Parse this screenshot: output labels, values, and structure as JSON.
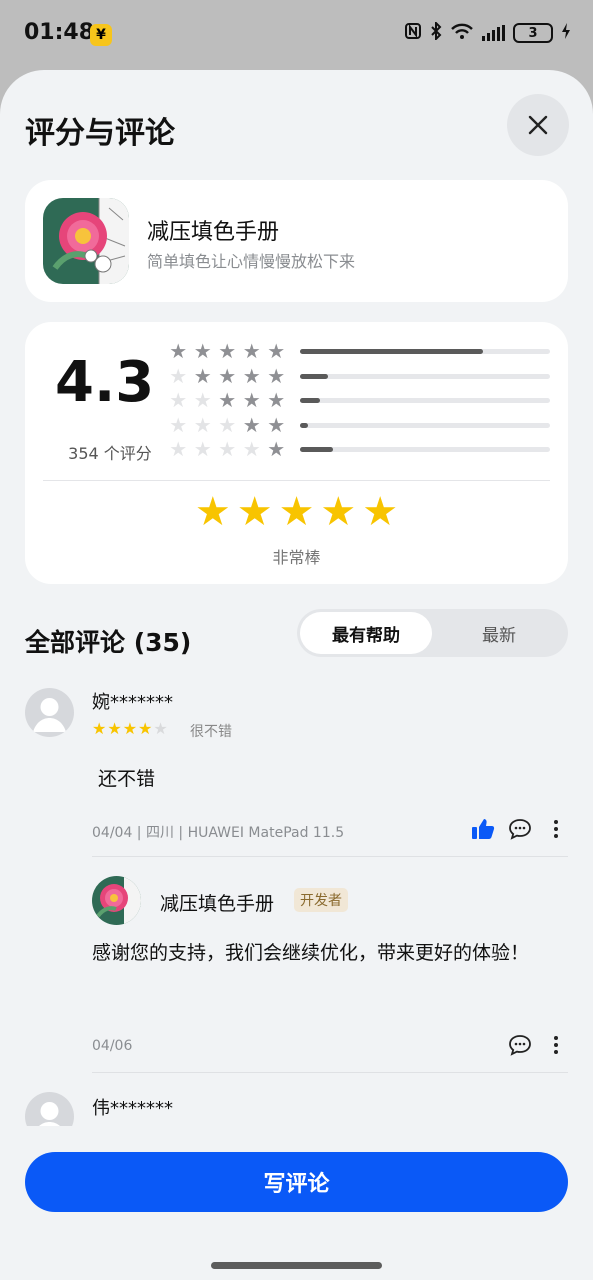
{
  "status": {
    "time": "01:48",
    "yuan": "¥",
    "battery": "3"
  },
  "sheet": {
    "title": "评分与评论"
  },
  "app": {
    "name": "减压填色手册",
    "description": "简单填色让心情慢慢放松下来"
  },
  "rating": {
    "score": "4.3",
    "count_text": "354 个评分",
    "distribution": [
      {
        "stars": 5,
        "fraction": 0.73
      },
      {
        "stars": 4,
        "fraction": 0.11
      },
      {
        "stars": 3,
        "fraction": 0.08
      },
      {
        "stars": 2,
        "fraction": 0.03
      },
      {
        "stars": 1,
        "fraction": 0.13
      }
    ],
    "rate_stars": 5,
    "rate_label": "非常棒"
  },
  "reviews_header": {
    "title": "全部评论 (35)",
    "tab_helpful": "最有帮助",
    "tab_latest": "最新"
  },
  "reviews": [
    {
      "user": "婉*******",
      "stars": 4,
      "stars_label": "很不错",
      "text": "还不错",
      "meta": "04/04 | 四川 | HUAWEI MatePad 11.5",
      "reply": {
        "name": "减压填色手册",
        "tag": "开发者",
        "text": "感谢您的支持，我们会继续优化，带来更好的体验！",
        "date": "04/06"
      }
    },
    {
      "user": "伟*******"
    }
  ],
  "write_button": "写评论",
  "colors": {
    "accent": "#0a59f7",
    "star": "#f8c400",
    "background": "#f1f3f5"
  }
}
